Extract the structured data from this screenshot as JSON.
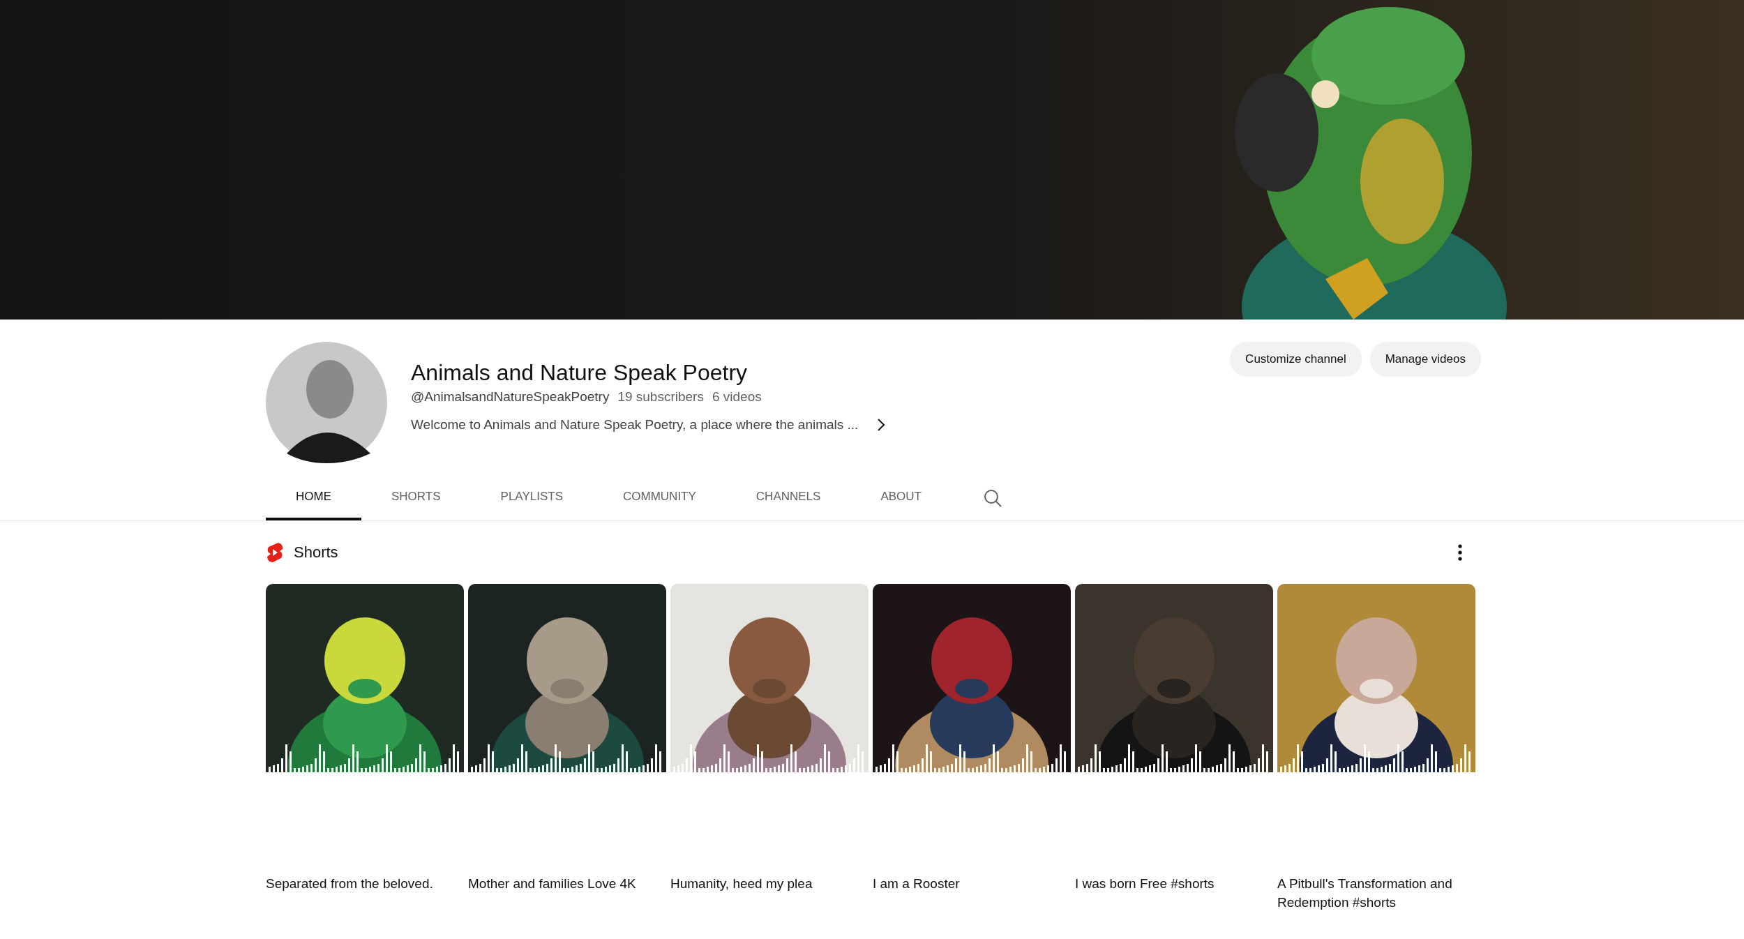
{
  "channel": {
    "name": "Animals and Nature Speak Poetry",
    "handle": "@AnimalsandNatureSpeakPoetry",
    "subscribers": "19 subscribers",
    "videos": "6 videos",
    "description": "Welcome to Animals and Nature Speak Poetry, a place where the animals ..."
  },
  "buttons": [
    "Customize channel",
    "Manage videos"
  ],
  "tabs": [
    {
      "label": "HOME",
      "selected": true
    },
    {
      "label": "SHORTS",
      "selected": false
    },
    {
      "label": "PLAYLISTS",
      "selected": false
    },
    {
      "label": "COMMUNITY",
      "selected": false
    },
    {
      "label": "CHANNELS",
      "selected": false
    },
    {
      "label": "ABOUT",
      "selected": false
    }
  ],
  "shorts": {
    "title": "Shorts",
    "items": [
      {
        "kind": "picture",
        "title": "Separated from the beloved."
      },
      {
        "kind": "picture",
        "title": "Mother and families Love 4K"
      },
      {
        "kind": "picture",
        "title": "Humanity, heed my plea"
      },
      {
        "kind": "picture",
        "title": "I am a Rooster"
      },
      {
        "kind": "picture",
        "title": "I was born Free #shorts"
      },
      {
        "kind": "picture",
        "title": "A Pitbull's Transformation and Redemption #shorts"
      }
    ]
  }
}
